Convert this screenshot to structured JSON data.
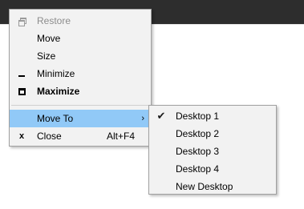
{
  "system_menu": {
    "items": [
      {
        "label": "Restore",
        "enabled": false,
        "icon": "restore-icon"
      },
      {
        "label": "Move",
        "enabled": true
      },
      {
        "label": "Size",
        "enabled": true
      },
      {
        "label": "Minimize",
        "enabled": true,
        "icon": "minimize-icon"
      },
      {
        "label": "Maximize",
        "enabled": true,
        "bold": true,
        "icon": "maximize-icon"
      },
      {
        "label": "Move To",
        "enabled": true,
        "highlighted": true,
        "submenu_arrow": "›"
      },
      {
        "label": "Close",
        "enabled": true,
        "icon": "close-icon",
        "icon_glyph": "x",
        "shortcut": "Alt+F4"
      }
    ]
  },
  "move_to_submenu": {
    "items": [
      {
        "label": "Desktop 1",
        "checked": true,
        "check_glyph": "✔"
      },
      {
        "label": "Desktop 2"
      },
      {
        "label": "Desktop 3"
      },
      {
        "label": "Desktop 4"
      },
      {
        "label": "New Desktop"
      }
    ]
  },
  "colors": {
    "titlebar": "#2d2d2d",
    "menu_background": "#f2f2f2",
    "menu_border": "#a0a0a0",
    "highlight": "#91c9f7",
    "disabled_text": "#8c8c8c"
  }
}
